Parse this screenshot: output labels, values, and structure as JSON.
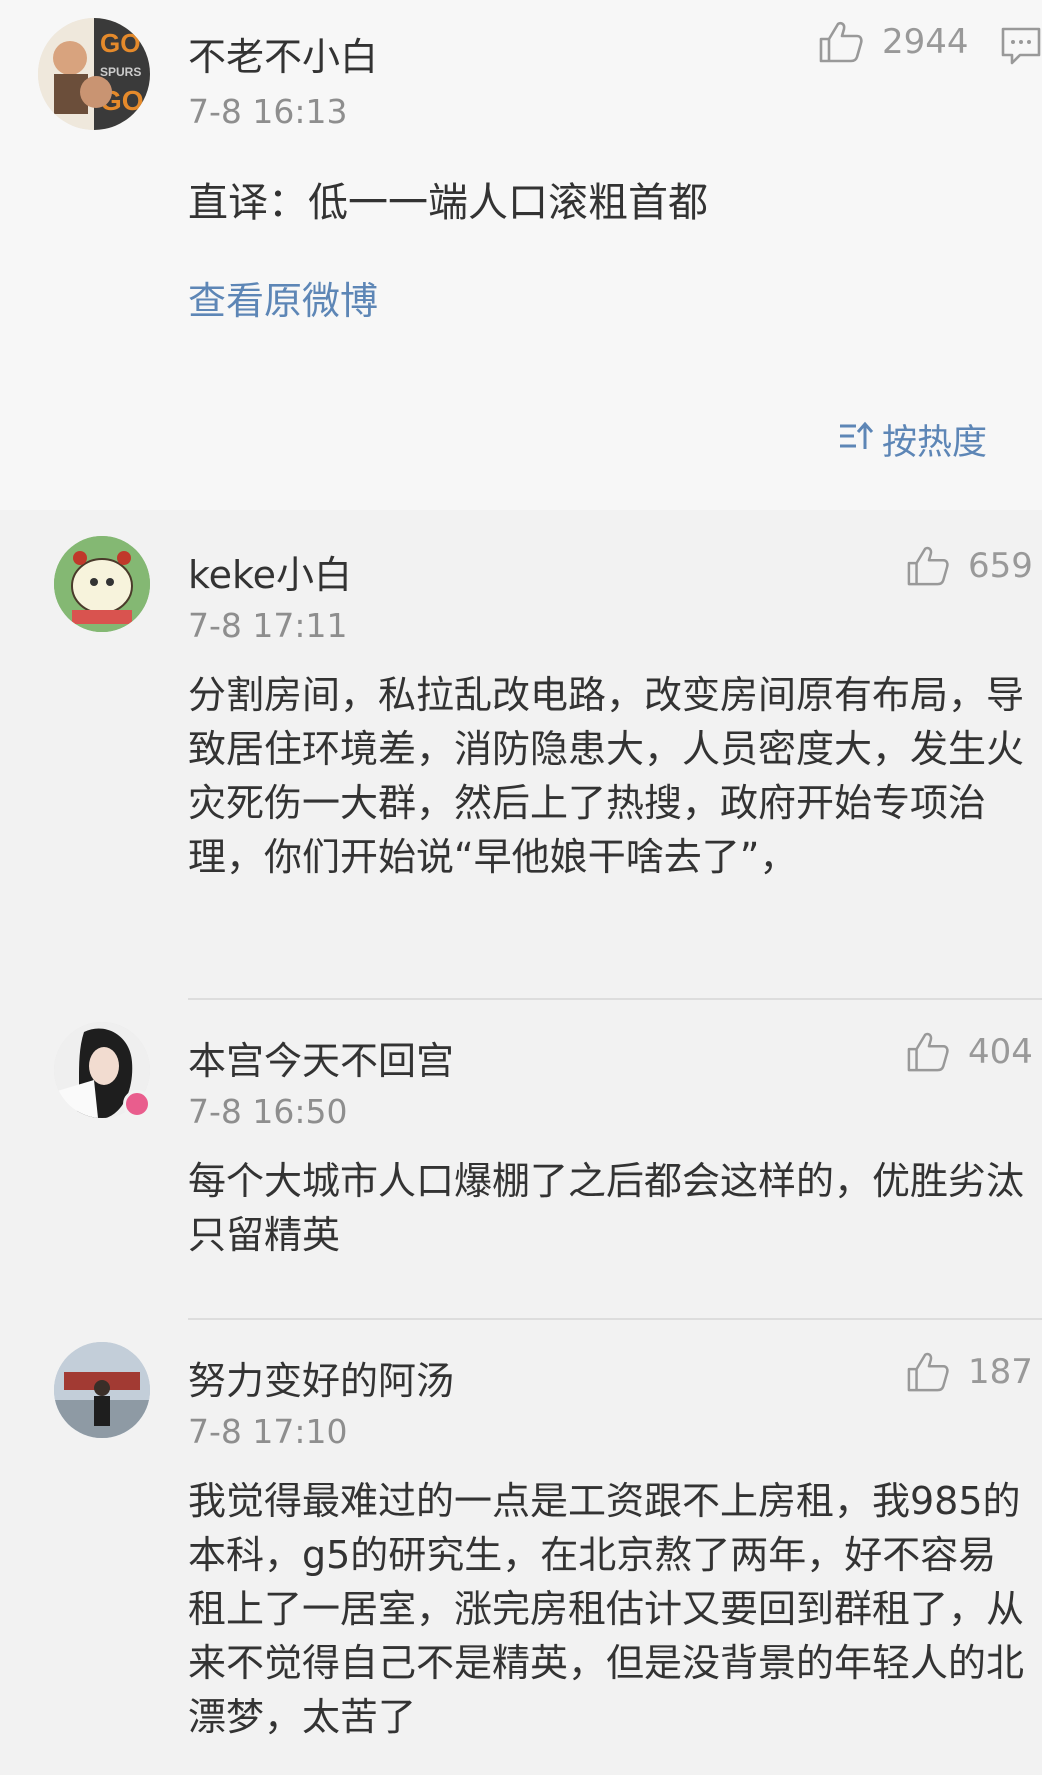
{
  "post": {
    "author": "不老不小白",
    "time": "7-8 16:13",
    "likes": "2944",
    "content": "直译：低一一端人口滚粗首都",
    "view_original": "查看原微博"
  },
  "sort": {
    "label": "按热度"
  },
  "comments": [
    {
      "author": "keke小白",
      "time": "7-8 17:11",
      "likes": "659",
      "content": "分割房间，私拉乱改电路，改变房间原有布局，导致居住环境差，消防隐患大，人员密度大，发生火灾死伤一大群，然后上了热搜，政府开始专项治理，你们开始说“早他娘干啥去了”，"
    },
    {
      "author": "本宫今天不回宫",
      "time": "7-8 16:50",
      "likes": "404",
      "content": "每个大城市人口爆棚了之后都会这样的，优胜劣汰只留精英"
    },
    {
      "author": "努力变好的阿汤",
      "time": "7-8 17:10",
      "likes": "187",
      "content": "我觉得最难过的一点是工资跟不上房租，我985的本科，g5的研究生，在北京熬了两年，好不容易租上了一居室，涨完房租估计又要回到群租了，从来不觉得自己不是精英，但是没背景的年轻人的北漂梦，太苦了"
    }
  ],
  "colors": {
    "link": "#5d86b6",
    "text": "#333333",
    "muted": "#8e8e8e",
    "badge": "#e95d8d"
  },
  "icons": [
    "thumbs-up-icon",
    "comment-icon",
    "sort-icon",
    "vip-badge-icon"
  ]
}
